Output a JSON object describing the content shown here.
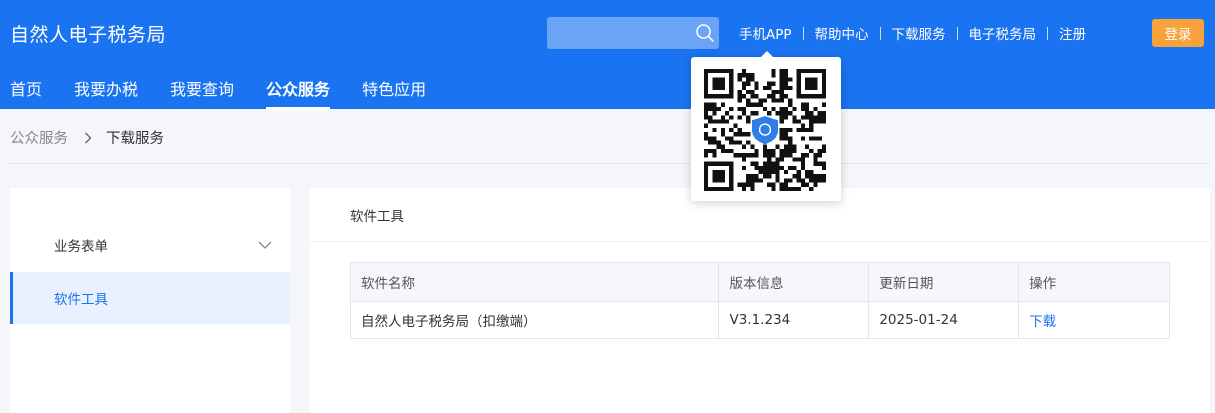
{
  "header": {
    "site_title": "自然人电子税务局",
    "search_placeholder": "",
    "top_links": [
      "手机APP",
      "帮助中心",
      "下载服务",
      "电子税务局",
      "注册"
    ],
    "login_label": "登录",
    "colors": {
      "brand_blue": "#1a73f0",
      "login_orange": "#f7a23b"
    }
  },
  "nav": {
    "items": [
      "首页",
      "我要办税",
      "我要查询",
      "公众服务",
      "特色应用"
    ],
    "active": "公众服务"
  },
  "breadcrumb": {
    "parent": "公众服务",
    "current": "下载服务"
  },
  "sidebar": {
    "items": [
      {
        "label": "业务表单",
        "icon": "chevron-down-icon"
      },
      {
        "label": "软件工具"
      }
    ],
    "active": "软件工具"
  },
  "main": {
    "section_title": "软件工具",
    "table": {
      "headers": [
        "软件名称",
        "版本信息",
        "更新日期",
        "操作"
      ],
      "rows": [
        {
          "name": "自然人电子税务局（扣缴端）",
          "version": "V3.1.234",
          "date": "2025-01-24",
          "action": "下载"
        }
      ]
    }
  },
  "qr_popover": {
    "icon": "qr-code-icon",
    "center_logo": "tax-shield-logo-icon"
  }
}
